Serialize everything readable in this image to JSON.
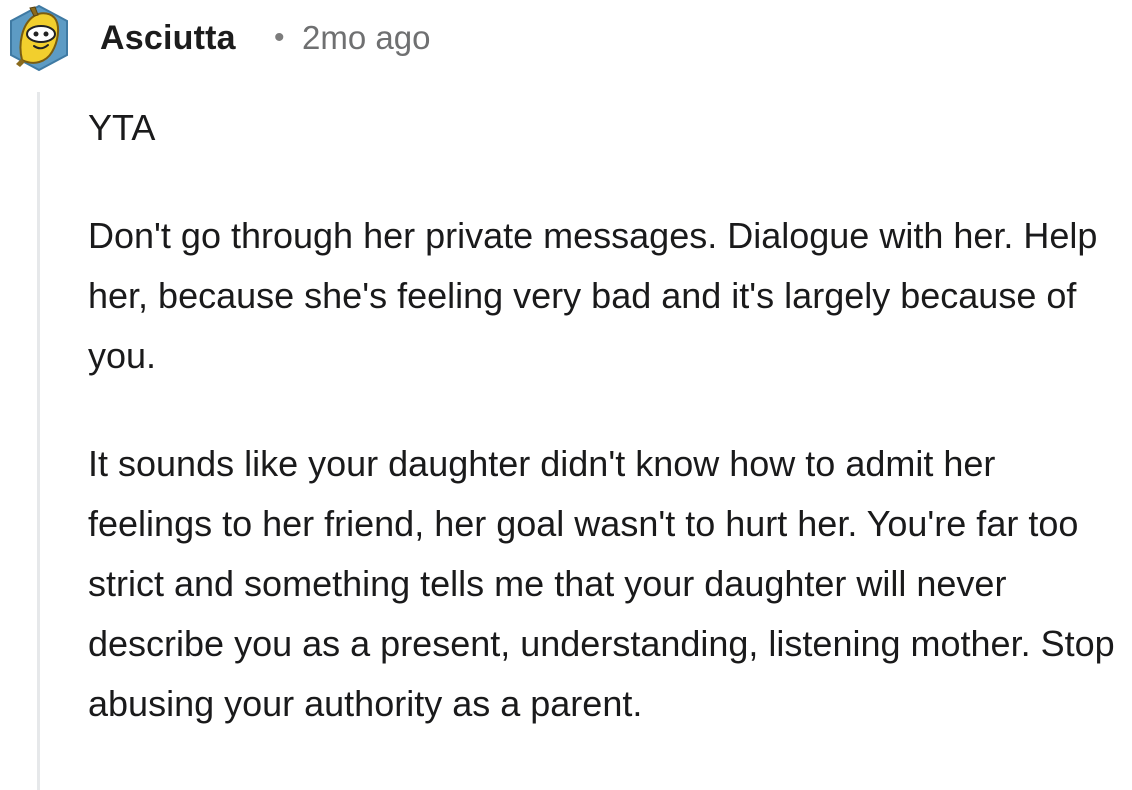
{
  "comment": {
    "author": "Asciutta",
    "separator": "•",
    "timestamp": "2mo ago",
    "avatar_icon": "banana-snoo-avatar-icon",
    "paragraphs": [
      "YTA",
      "Don't go through her private messages. Dialogue with her. Help her, because she's feeling very bad and it's largely because of you.",
      "It sounds like your daughter didn't know how to admit her feelings to her friend, her goal wasn't to hurt her. You're far too strict and something tells me that your daughter will never describe you as a present, understanding, listening mother. Stop abusing your authority as a parent."
    ]
  },
  "colors": {
    "avatar_badge": "#5d9bc4",
    "avatar_banana": "#f2cf2d",
    "thread_line": "#e6e8ea",
    "meta_text": "#6f7071"
  }
}
